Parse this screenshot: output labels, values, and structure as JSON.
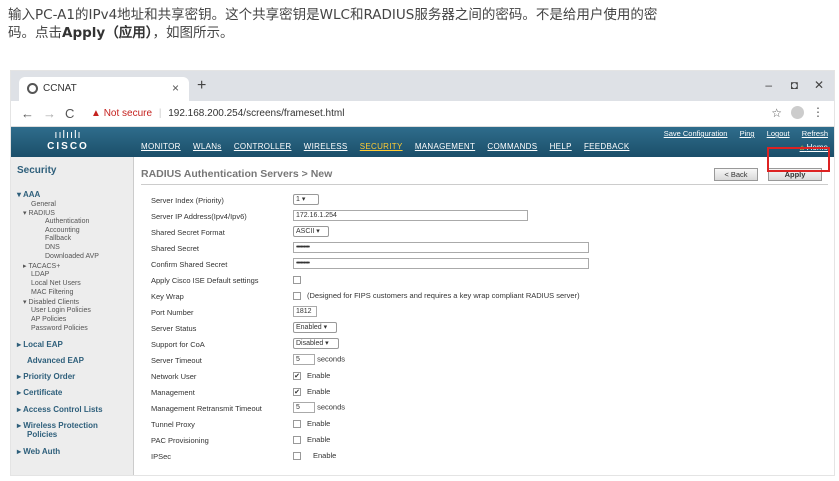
{
  "intro": {
    "line1": "输入PC-A1的IPv4地址和共享密钥。这个共享密钥是WLC和RADIUS服务器之间的密码。不是给用户使用的密",
    "line2_pre": "码。点击",
    "line2_bold": "Apply（应用）",
    "line2_post": "，如图所示。"
  },
  "browser": {
    "tab_title": "CCNAT",
    "tab_close": "×",
    "new_tab": "+",
    "not_secure": "Not secure",
    "url": "192.168.200.254/screens/frameset.html",
    "minimize": "–",
    "restore": "◘",
    "close": "✕"
  },
  "cisco": {
    "logo_bars": "ıılıılı",
    "logo_name": "CISCO",
    "menu": [
      "MONITOR",
      "WLANs",
      "CONTROLLER",
      "WIRELESS",
      "SECURITY",
      "MANAGEMENT",
      "COMMANDS",
      "HELP",
      "FEEDBACK"
    ],
    "active_menu": "SECURITY",
    "top_links": [
      "Save Configuration",
      "Ping",
      "Logout",
      "Refresh"
    ],
    "home": "Home"
  },
  "sidebar": {
    "title": "Security",
    "items": [
      {
        "label": "▾ AAA",
        "kind": "sec"
      },
      {
        "label": "General",
        "kind": "sub"
      },
      {
        "label": "▾ RADIUS",
        "kind": "sub"
      },
      {
        "label": "Authentication",
        "kind": "sub2"
      },
      {
        "label": "Accounting",
        "kind": "sub2"
      },
      {
        "label": "Fallback",
        "kind": "sub2"
      },
      {
        "label": "DNS",
        "kind": "sub2"
      },
      {
        "label": "Downloaded AVP",
        "kind": "sub2"
      },
      {
        "label": "▸ TACACS+",
        "kind": "sub"
      },
      {
        "label": "LDAP",
        "kind": "sub"
      },
      {
        "label": "Local Net Users",
        "kind": "sub"
      },
      {
        "label": "MAC Filtering",
        "kind": "sub"
      },
      {
        "label": "▾ Disabled Clients",
        "kind": "sub"
      },
      {
        "label": "User Login Policies",
        "kind": "sub"
      },
      {
        "label": "AP Policies",
        "kind": "sub"
      },
      {
        "label": "Password Policies",
        "kind": "sub"
      },
      {
        "label": "▸ Local EAP",
        "kind": "sec"
      },
      {
        "label": "Advanced EAP",
        "kind": "sec"
      },
      {
        "label": "▸ Priority Order",
        "kind": "sec"
      },
      {
        "label": "▸ Certificate",
        "kind": "sec"
      },
      {
        "label": "▸ Access Control Lists",
        "kind": "sec"
      },
      {
        "label": "▸ Wireless Protection",
        "kind": "sec"
      },
      {
        "label": "Policies",
        "kind": "sec"
      },
      {
        "label": "▸ Web Auth",
        "kind": "sec"
      }
    ]
  },
  "page": {
    "title": "RADIUS Authentication Servers > New",
    "back_button": "< Back",
    "apply_button": "Apply"
  },
  "form": {
    "server_index_label": "Server Index (Priority)",
    "server_index_value": "1 ▾",
    "server_ip_label": "Server IP Address(Ipv4/Ipv6)",
    "server_ip_value": "172.16.1.254",
    "secret_format_label": "Shared Secret Format",
    "secret_format_value": "ASCII ▾",
    "secret_label": "Shared Secret",
    "secret_value": "•••••••••",
    "confirm_label": "Confirm Shared Secret",
    "confirm_value": "•••••••••",
    "ise_label": "Apply Cisco ISE Default settings",
    "keywrap_label": "Key Wrap",
    "keywrap_note": "(Designed for FIPS customers and requires a key wrap compliant RADIUS server)",
    "port_label": "Port Number",
    "port_value": "1812",
    "status_label": "Server Status",
    "status_value": "Enabled ▾",
    "coa_label": "Support for CoA",
    "coa_value": "Disabled ▾",
    "timeout_label": "Server Timeout",
    "timeout_value": "5",
    "timeout_unit": "seconds",
    "netuser_label": "Network User",
    "netuser_text": "Enable",
    "mgmt_label": "Management",
    "mgmt_text": "Enable",
    "mgmt_retx_label": "Management Retransmit Timeout",
    "mgmt_retx_value": "5",
    "mgmt_retx_unit": "seconds",
    "tunnel_label": "Tunnel Proxy",
    "tunnel_text": "Enable",
    "pac_label": "PAC Provisioning",
    "pac_text": "Enable",
    "ipsec_label": "IPSec",
    "ipsec_text": "Enable"
  }
}
